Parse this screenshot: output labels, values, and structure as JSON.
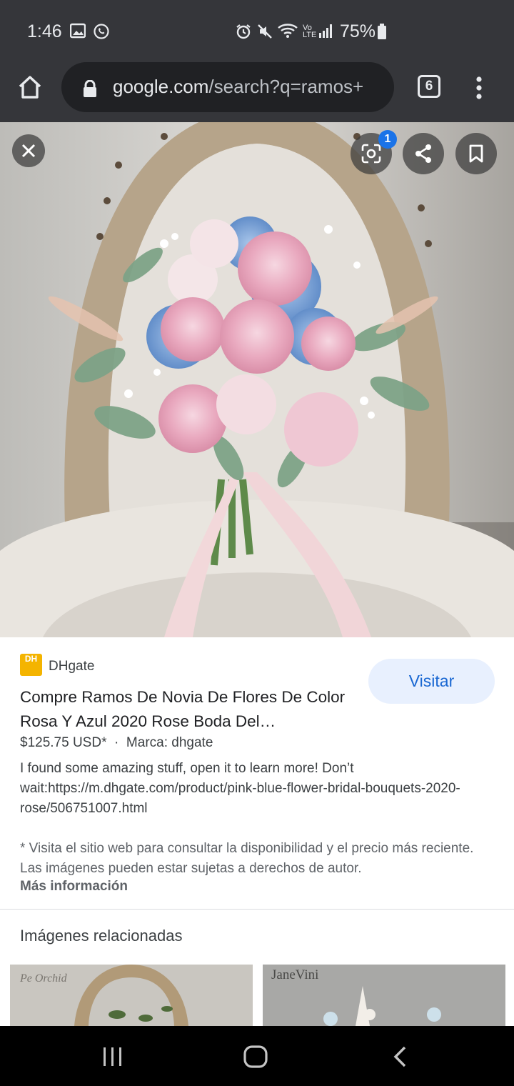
{
  "status": {
    "time": "1:46",
    "battery": "75%",
    "lte": "Vo LTE"
  },
  "url_bar": {
    "domain": "google.com",
    "path": "/search?q=ramos+",
    "tab_count": "6"
  },
  "hero": {
    "lens_badge": "1"
  },
  "result": {
    "source": "DHgate",
    "logo_text": "DH",
    "visit_label": "Visitar",
    "title": "Compre Ramos De Novia De Flores De Color Rosa Y Azul 2020 Rose Boda Del…",
    "price": "$125.75 USD*",
    "separator": "·",
    "brand": "Marca: dhgate",
    "description": "I found some amazing stuff, open it to learn more! Don’t wait:https://m.dhgate.com/product/pink-blue-flower-bridal-bouquets-2020-rose/506751007.html",
    "note": "* Visita el sitio web para consultar la disponibilidad y el precio más reciente. Las imágenes pueden estar sujetas a derechos de autor.",
    "more_label": "Más información"
  },
  "related": {
    "heading": "Imágenes relacionadas",
    "thumb1_brand": "Pe Orchid",
    "thumb2_brand": "JaneVini"
  }
}
